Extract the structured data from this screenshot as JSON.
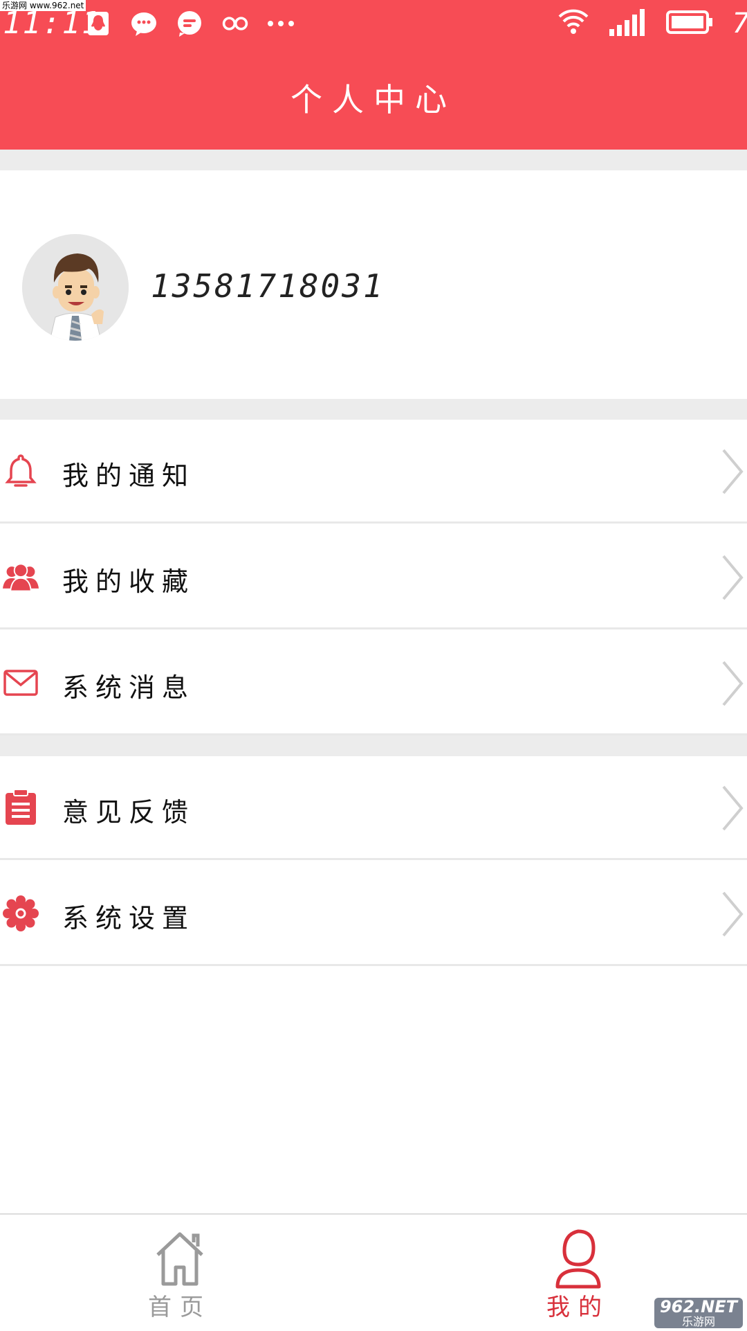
{
  "status_bar": {
    "time": "11:11",
    "battery_level": "7",
    "icons": [
      "qq-icon",
      "wechat-icon",
      "message-icon",
      "infinity-icon",
      "more-dots-icon"
    ],
    "watermark": "乐游网 www.962.net"
  },
  "header": {
    "title": "个人中心"
  },
  "profile": {
    "phone": "13581718031"
  },
  "menu_group_1": [
    {
      "label": "我的通知",
      "icon": "bell-icon"
    },
    {
      "label": "我的收藏",
      "icon": "people-icon"
    },
    {
      "label": "系统消息",
      "icon": "mail-icon"
    }
  ],
  "menu_group_2": [
    {
      "label": "意见反馈",
      "icon": "clipboard-icon"
    },
    {
      "label": "系统设置",
      "icon": "gear-icon"
    }
  ],
  "tabbar": {
    "home_label": "首页",
    "mine_label": "我的",
    "active": "mine"
  },
  "watermark_bottom": {
    "line1": "962.NET",
    "line2": "乐游网"
  },
  "colors": {
    "accent": "#f74c55",
    "divider": "#ececec",
    "inactive_tab": "#9a9a9a"
  }
}
